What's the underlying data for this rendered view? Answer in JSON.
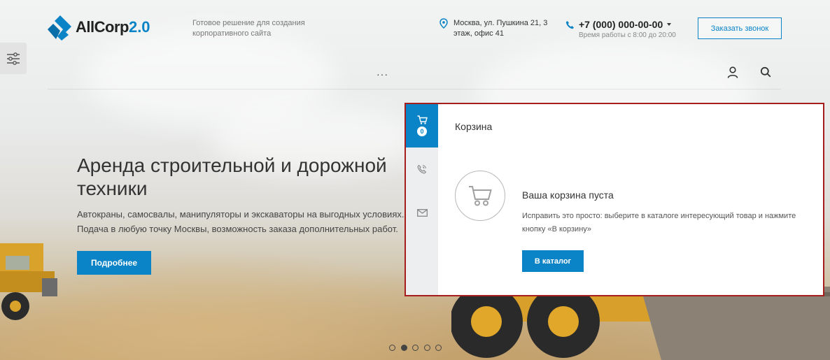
{
  "colors": {
    "accent": "#0a84c7",
    "highlight_border": "#a51d1d"
  },
  "header": {
    "logo_main": "AllCorp",
    "logo_version": "2.0",
    "tagline": "Готовое решение для создания корпоративного сайта",
    "address": "Москва, ул. Пушкина 21, 3 этаж, офис 41",
    "phone": "+7 (000) 000-00-00",
    "hours": "Время работы с 8:00 до 20:00",
    "callback_label": "Заказать звонок",
    "menu_dots": "···",
    "icons": [
      "settings-icon",
      "location-icon",
      "phone-icon",
      "user-icon",
      "search-icon"
    ]
  },
  "hero": {
    "title": "Аренда строительной и дорожной техники",
    "description": "Автокраны, самосвалы, манипуляторы и экскаваторы на выгодных условиях. Подача в любую точку Москвы, возможность заказа дополнительных работ.",
    "button_label": "Подробнее",
    "slides_total": 5,
    "active_slide": 2
  },
  "cart_panel": {
    "tabs": [
      {
        "icon": "cart-icon",
        "badge": "0"
      },
      {
        "icon": "phone-call-icon"
      },
      {
        "icon": "mail-icon"
      }
    ],
    "title": "Корзина",
    "empty_title": "Ваша корзина пуста",
    "empty_desc": "Исправить это просто: выберите в каталоге интересующий товар и нажмите кнопку «В корзину»",
    "catalog_button": "В каталог"
  }
}
